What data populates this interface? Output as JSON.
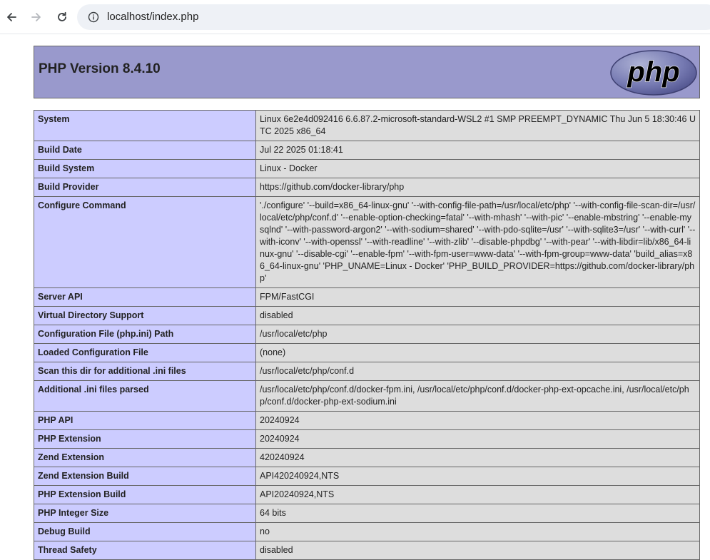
{
  "browser": {
    "url": "localhost/index.php"
  },
  "header": {
    "title": "PHP Version 8.4.10",
    "logo_text": "php"
  },
  "rows": [
    {
      "key": "System",
      "value": "Linux 6e2e4d092416 6.6.87.2-microsoft-standard-WSL2 #1 SMP PREEMPT_DYNAMIC Thu Jun 5 18:30:46 UTC 2025 x86_64"
    },
    {
      "key": "Build Date",
      "value": "Jul 22 2025 01:18:41"
    },
    {
      "key": "Build System",
      "value": "Linux - Docker"
    },
    {
      "key": "Build Provider",
      "value": "https://github.com/docker-library/php"
    },
    {
      "key": "Configure Command",
      "value": "'./configure' '--build=x86_64-linux-gnu' '--with-config-file-path=/usr/local/etc/php' '--with-config-file-scan-dir=/usr/local/etc/php/conf.d' '--enable-option-checking=fatal' '--with-mhash' '--with-pic' '--enable-mbstring' '--enable-mysqlnd' '--with-password-argon2' '--with-sodium=shared' '--with-pdo-sqlite=/usr' '--with-sqlite3=/usr' '--with-curl' '--with-iconv' '--with-openssl' '--with-readline' '--with-zlib' '--disable-phpdbg' '--with-pear' '--with-libdir=lib/x86_64-linux-gnu' '--disable-cgi' '--enable-fpm' '--with-fpm-user=www-data' '--with-fpm-group=www-data' 'build_alias=x86_64-linux-gnu' 'PHP_UNAME=Linux - Docker' 'PHP_BUILD_PROVIDER=https://github.com/docker-library/php'"
    },
    {
      "key": "Server API",
      "value": "FPM/FastCGI"
    },
    {
      "key": "Virtual Directory Support",
      "value": "disabled"
    },
    {
      "key": "Configuration File (php.ini) Path",
      "value": "/usr/local/etc/php"
    },
    {
      "key": "Loaded Configuration File",
      "value": "(none)"
    },
    {
      "key": "Scan this dir for additional .ini files",
      "value": "/usr/local/etc/php/conf.d"
    },
    {
      "key": "Additional .ini files parsed",
      "value": "/usr/local/etc/php/conf.d/docker-fpm.ini, /usr/local/etc/php/conf.d/docker-php-ext-opcache.ini, /usr/local/etc/php/conf.d/docker-php-ext-sodium.ini"
    },
    {
      "key": "PHP API",
      "value": "20240924"
    },
    {
      "key": "PHP Extension",
      "value": "20240924"
    },
    {
      "key": "Zend Extension",
      "value": "420240924"
    },
    {
      "key": "Zend Extension Build",
      "value": "API420240924,NTS"
    },
    {
      "key": "PHP Extension Build",
      "value": "API20240924,NTS"
    },
    {
      "key": "PHP Integer Size",
      "value": "64 bits"
    },
    {
      "key": "Debug Build",
      "value": "no"
    },
    {
      "key": "Thread Safety",
      "value": "disabled"
    }
  ]
}
